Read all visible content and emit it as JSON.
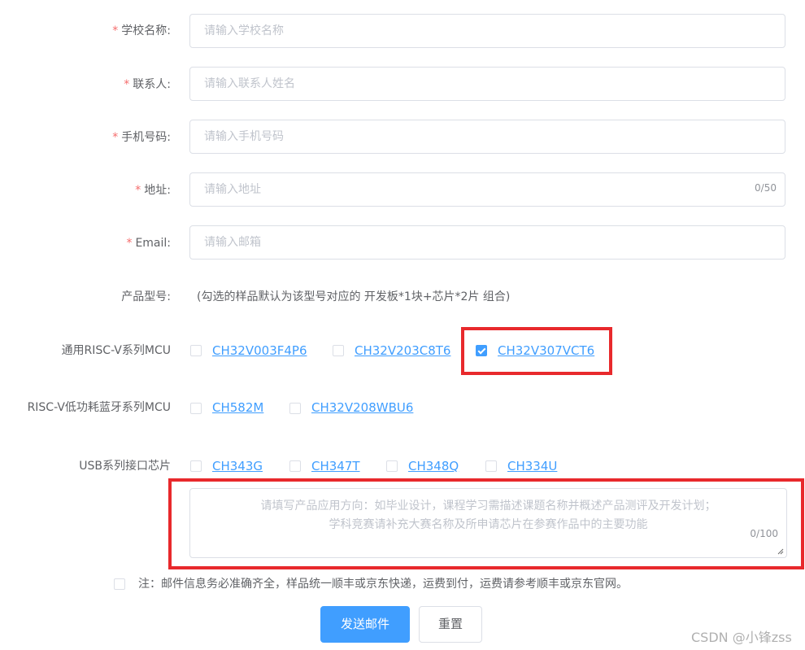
{
  "form": {
    "school": {
      "label": "学校名称:",
      "placeholder": "请输入学校名称"
    },
    "contact": {
      "label": "联系人:",
      "placeholder": "请输入联系人姓名"
    },
    "phone": {
      "label": "手机号码:",
      "placeholder": "请输入手机号码"
    },
    "address": {
      "label": "地址:",
      "placeholder": "请输入地址",
      "counter": "0/50"
    },
    "email": {
      "label": "Email:",
      "placeholder": "请输入邮箱"
    },
    "required_mark": "*"
  },
  "product": {
    "label": "产品型号:",
    "hint": "(勾选的样品默认为该型号对应的 开发板*1块+芯片*2片 组合)"
  },
  "groups": {
    "general_mcu": {
      "label": "通用RISC-V系列MCU",
      "items": [
        {
          "name": "CH32V003F4P6",
          "checked": false
        },
        {
          "name": "CH32V203C8T6",
          "checked": false
        },
        {
          "name": "CH32V307VCT6",
          "checked": true
        }
      ]
    },
    "ble_mcu": {
      "label": "RISC-V低功耗蓝牙系列MCU",
      "items": [
        {
          "name": "CH582M",
          "checked": false
        },
        {
          "name": "CH32V208WBU6",
          "checked": false
        }
      ]
    },
    "usb_chip": {
      "label": "USB系列接口芯片",
      "items": [
        {
          "name": "CH343G",
          "checked": false
        },
        {
          "name": "CH347T",
          "checked": false
        },
        {
          "name": "CH348Q",
          "checked": false
        },
        {
          "name": "CH334U",
          "checked": false
        }
      ]
    }
  },
  "application": {
    "placeholder_line1": "请填写产品应用方向：如毕业设计，课程学习需描述课题名称并概述产品测评及开发计划；",
    "placeholder_line2": "学科竞赛请补充大赛名称及所申请芯片在参赛作品中的主要功能",
    "counter": "0/100"
  },
  "note": {
    "text": "注：邮件信息务必准确齐全，样品统一顺丰或京东快递，运费到付，运费请参考顺丰或京东官网。",
    "checked": false
  },
  "buttons": {
    "submit": "发送邮件",
    "reset": "重置"
  },
  "watermark": "CSDN @小锋zss",
  "colors": {
    "primary": "#409eff",
    "highlight": "#e8292c",
    "required": "#f56c6c"
  }
}
